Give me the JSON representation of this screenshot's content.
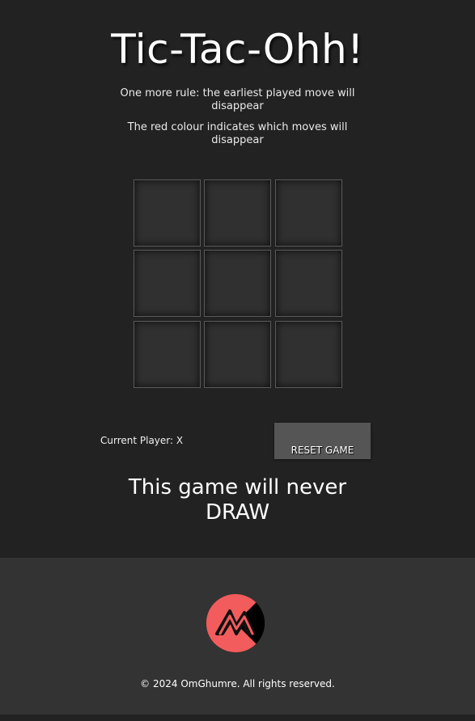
{
  "title": "Tic-Tac-Ohh!",
  "rules": [
    "One more rule: the earliest played move will disappear",
    "The red colour indicates which moves will disappear"
  ],
  "board": {
    "cells": [
      "",
      "",
      "",
      "",
      "",
      "",
      "",
      "",
      ""
    ]
  },
  "status": {
    "current_player": "Current Player: X"
  },
  "controls": {
    "reset_label": "RESET GAME"
  },
  "tagline": "This game will never DRAW",
  "footer": {
    "logo_icon": "om-logo-icon",
    "copyright": "© 2024 OmGhumre. All rights reserved."
  },
  "colors": {
    "background": "#222222",
    "footer_background": "#333333",
    "cell_background": "#303030",
    "button_background": "#555555",
    "logo_red": "#f25c5c",
    "logo_dark": "#000000"
  }
}
